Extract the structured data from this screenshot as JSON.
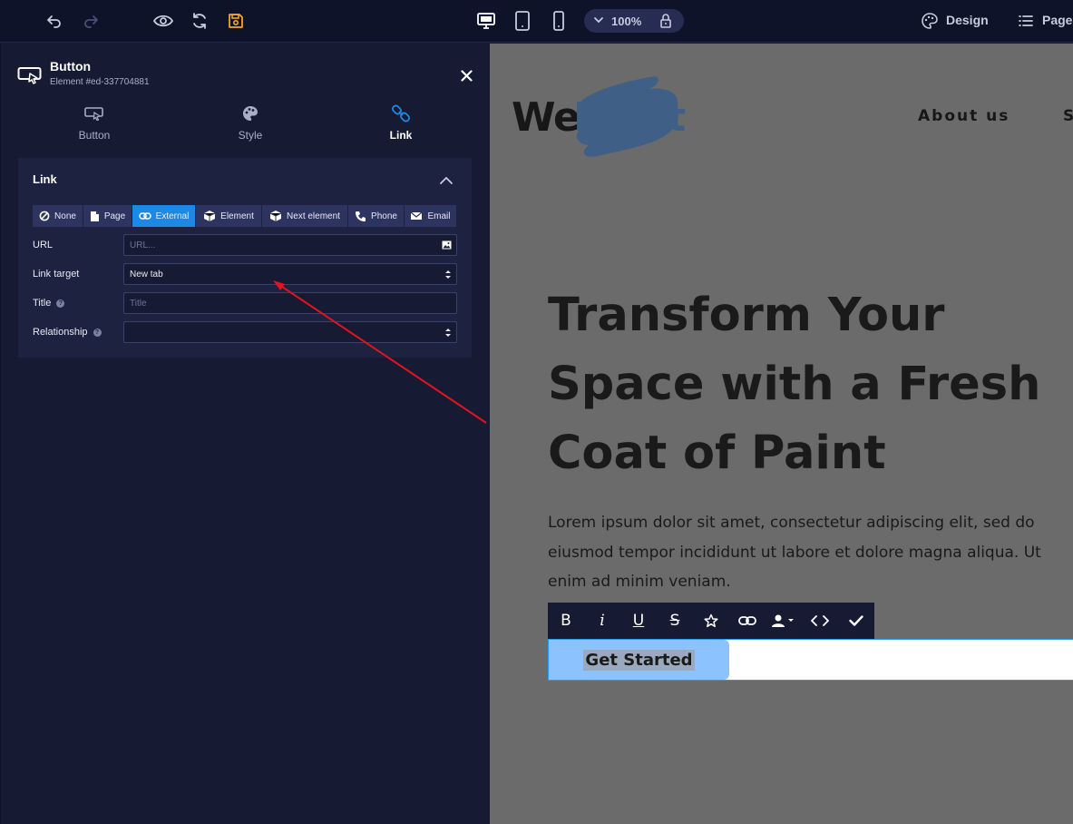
{
  "topbar": {
    "zoom": "100%",
    "design_label": "Design",
    "pages_label": "Pages"
  },
  "panel": {
    "title": "Button",
    "subtitle": "Element #ed-337704881",
    "tabs": [
      {
        "label": "Button",
        "icon": "button-icon"
      },
      {
        "label": "Style",
        "icon": "palette-icon"
      },
      {
        "label": "Link",
        "icon": "link-icon"
      }
    ],
    "active_tab": "Link",
    "section_title": "Link",
    "link_types": [
      {
        "label": "None",
        "icon": "ban-icon"
      },
      {
        "label": "Page",
        "icon": "page-icon"
      },
      {
        "label": "External",
        "icon": "link-icon"
      },
      {
        "label": "Element",
        "icon": "cube-icon"
      },
      {
        "label": "Next element",
        "icon": "cube-icon"
      },
      {
        "label": "Phone",
        "icon": "phone-icon"
      },
      {
        "label": "Email",
        "icon": "envelope-icon"
      }
    ],
    "active_link_type": "External",
    "fields": {
      "url_label": "URL",
      "url_placeholder": "URL...",
      "target_label": "Link target",
      "target_value": "New tab",
      "title_label": "Title",
      "title_placeholder": "Title",
      "rel_label": "Relationship",
      "rel_value": ""
    }
  },
  "canvas": {
    "logo_we": "We",
    "logo_paint": "Paint",
    "nav": [
      "About us",
      "S"
    ],
    "hero_title": "Transform Your Space with a Fresh Coat of Paint",
    "hero_body": "Lorem ipsum dolor sit amet, consectetur adipiscing elit, sed do eiusmod tempor incididunt ut labore et dolore magna aliqua. Ut enim ad minim veniam.",
    "cta": "Get Started",
    "format_tools": [
      "B",
      "i",
      "U",
      "S"
    ]
  },
  "colors": {
    "accent": "#1e88e5",
    "save_icon": "#f5a623",
    "sidebar_bg": "#161b33",
    "canvas_bg": "#6b6b6b",
    "annotation_arrow": "#e0141e"
  }
}
